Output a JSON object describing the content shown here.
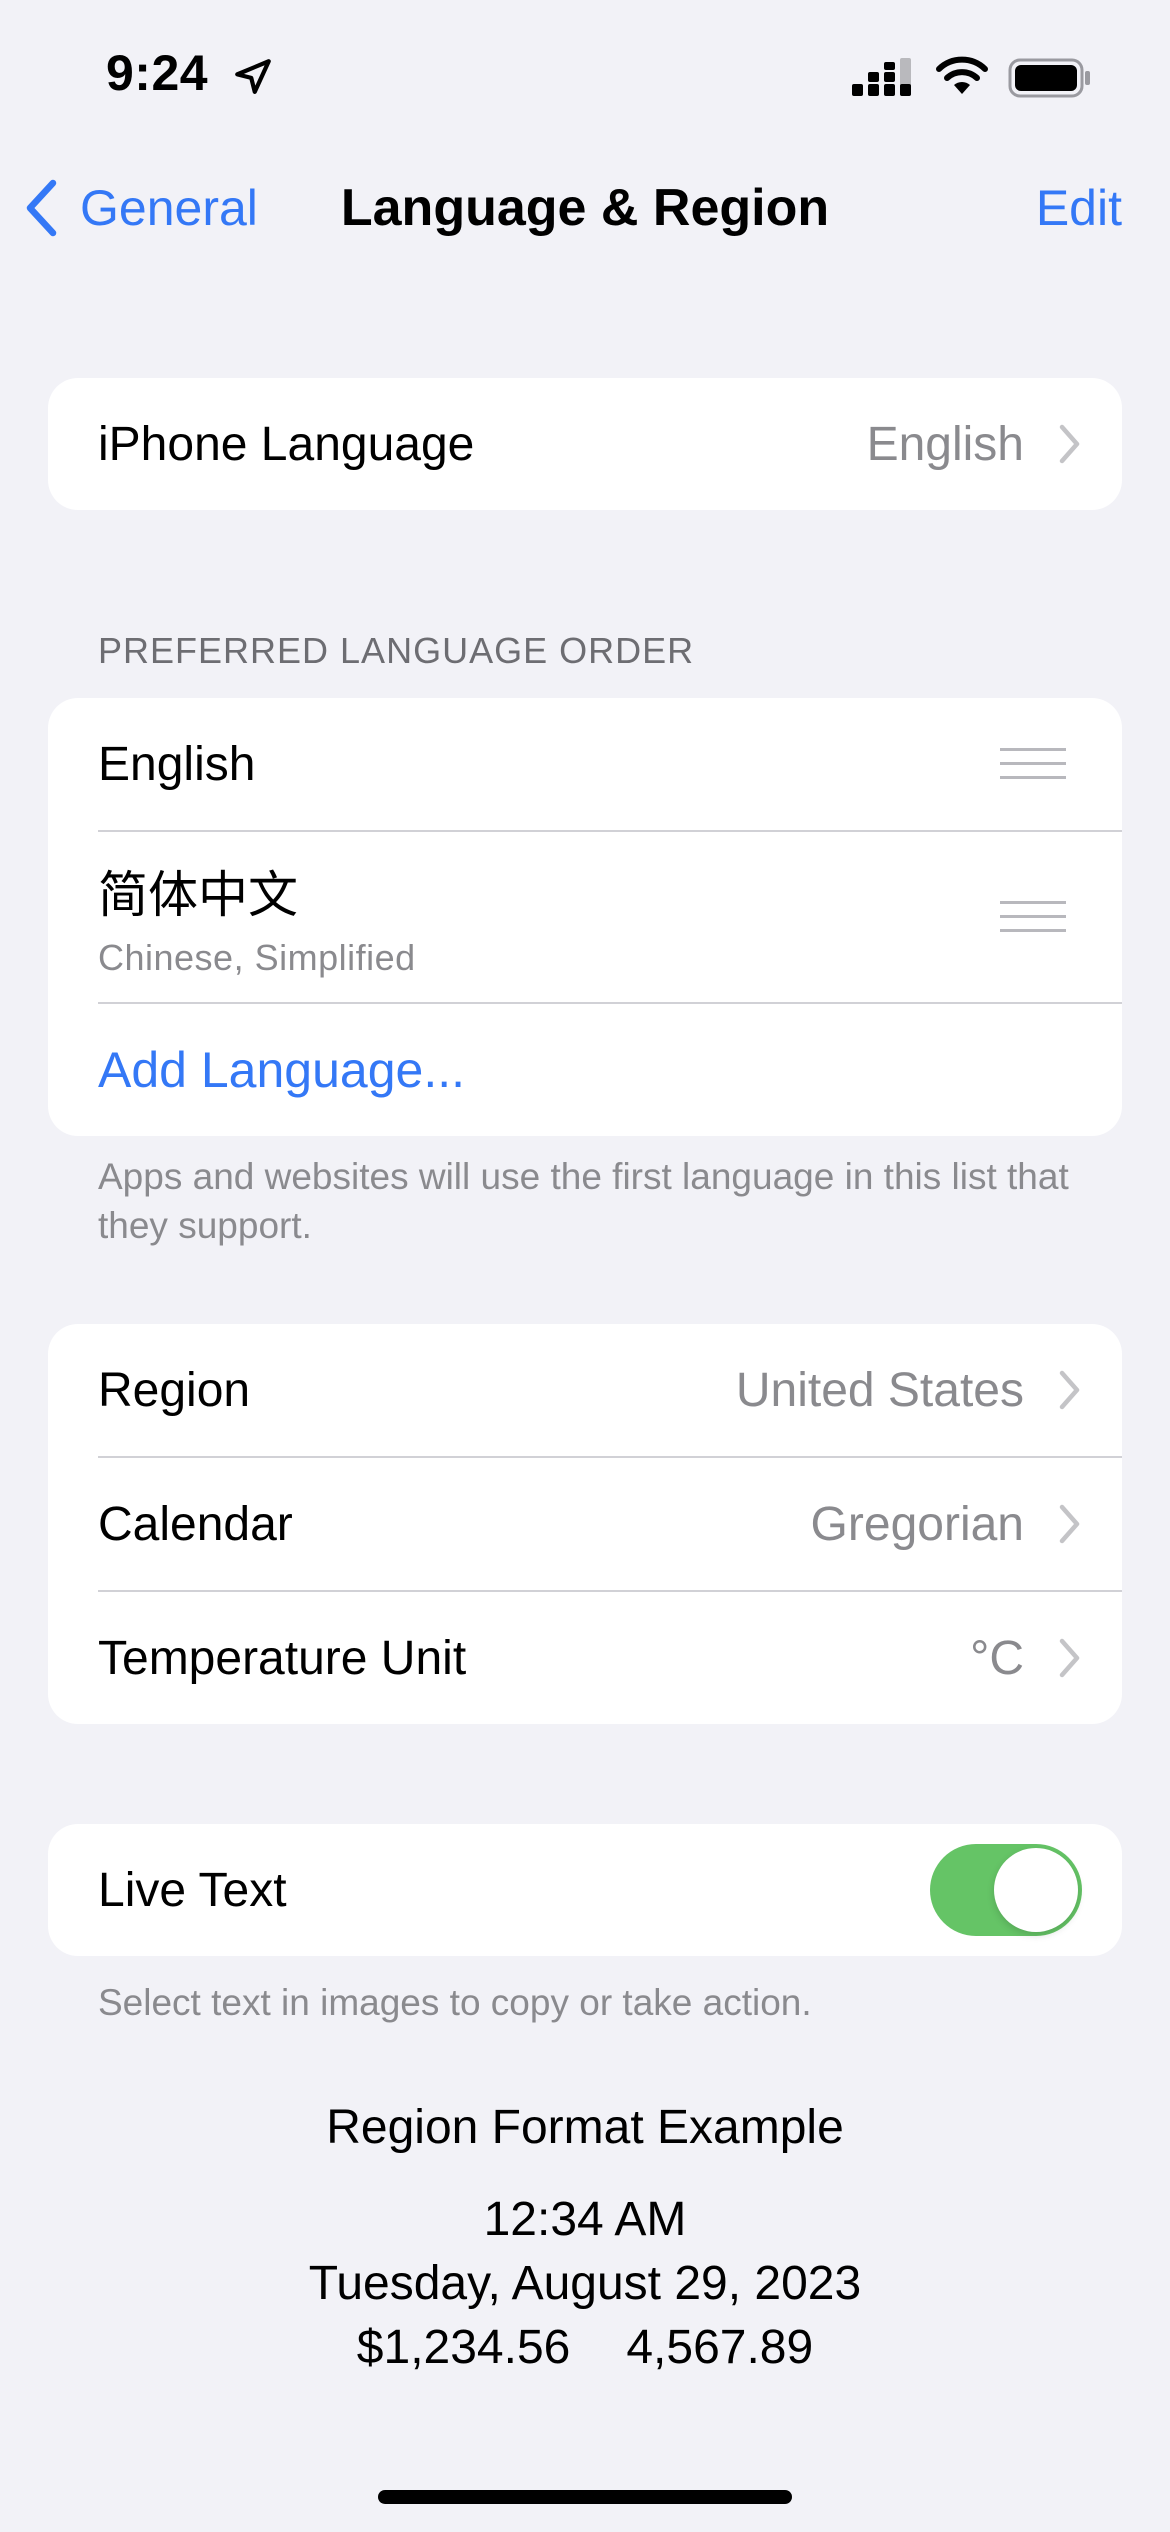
{
  "status_bar": {
    "time": "9:24",
    "icons": [
      "location-arrow-icon",
      "cellular-signal-icon",
      "wifi-icon",
      "battery-icon"
    ]
  },
  "nav": {
    "back_label": "General",
    "title": "Language & Region",
    "edit_label": "Edit"
  },
  "iphone_language": {
    "label": "iPhone Language",
    "value": "English"
  },
  "preferred": {
    "header": "PREFERRED LANGUAGE ORDER",
    "languages": [
      {
        "name": "English"
      },
      {
        "name": "简体中文",
        "subtitle": "Chinese, Simplified"
      }
    ],
    "add_label": "Add Language...",
    "footer": "Apps and websites will use the first language in this list that they support."
  },
  "region_settings": [
    {
      "label": "Region",
      "value": "United States"
    },
    {
      "label": "Calendar",
      "value": "Gregorian"
    },
    {
      "label": "Temperature Unit",
      "value": "°C"
    }
  ],
  "live_text": {
    "label": "Live Text",
    "enabled": true,
    "footer": "Select text in images to copy or take action."
  },
  "format_example": {
    "title": "Region Format Example",
    "time": "12:34 AM",
    "date": "Tuesday, August 29, 2023",
    "currency": "$1,234.56",
    "number": "4,567.89"
  },
  "colors": {
    "accent": "#3478f6",
    "toggle_on": "#65c466",
    "background": "#f2f2f7"
  }
}
